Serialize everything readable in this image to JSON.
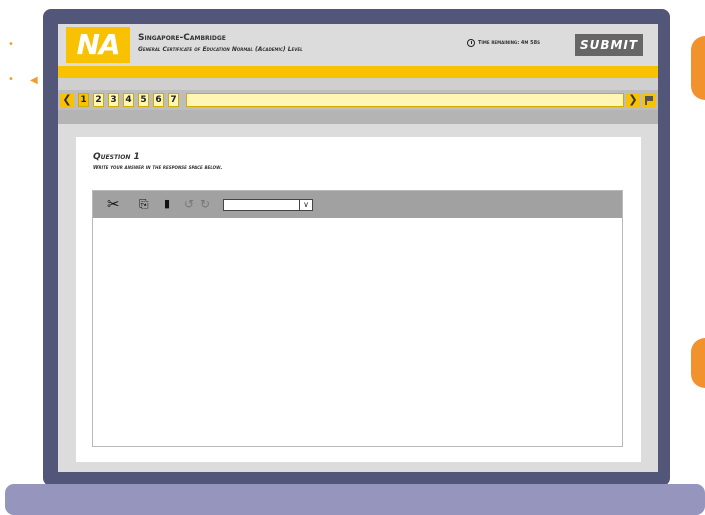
{
  "header": {
    "logo_text": "NA",
    "title": "Singapore-Cambridge",
    "subtitle": "General Certificate of Education Normal (Academic) Level",
    "timer_text": "Time remaining: 4m 58s",
    "submit_label": "SUBMIT"
  },
  "nav": {
    "prev_icon": "chevron-left-icon",
    "next_icon": "chevron-right-icon",
    "flag_icon": "flag-icon",
    "questions": [
      "1",
      "2",
      "3",
      "4",
      "5",
      "6",
      "7"
    ],
    "active_question": "1"
  },
  "question": {
    "title": "Question 1",
    "instruction": "Write your answer in the response space below."
  },
  "toolbar": {
    "tools": [
      "cut-icon",
      "copy-icon",
      "paste-icon",
      "undo-icon",
      "redo-icon"
    ],
    "format_select_value": ""
  },
  "colors": {
    "accent": "#f8c101",
    "frame": "#525779",
    "base": "#9595bd",
    "submit": "#666666",
    "decoration": "#f2922d"
  }
}
